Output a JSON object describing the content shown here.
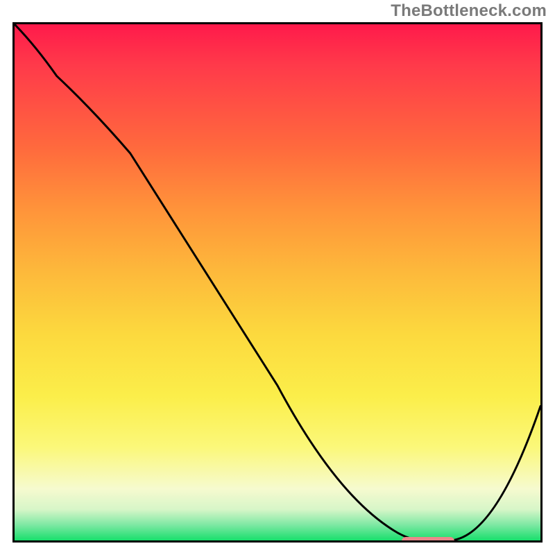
{
  "watermark": "TheBottleneck.com",
  "colors": {
    "border": "#000000",
    "curve": "#000000",
    "marker": "#e9878a",
    "gradient_stops": [
      "#ff1a4b",
      "#ff3a4a",
      "#ff6a3d",
      "#ff943a",
      "#fdb93b",
      "#fcd93e",
      "#fbee4a",
      "#fbf87a",
      "#f6facf",
      "#d7f6c8",
      "#7de8a3",
      "#18df6c"
    ]
  },
  "chart_data": {
    "type": "line",
    "title": "",
    "xlabel": "",
    "ylabel": "",
    "xlim": [
      0,
      100
    ],
    "ylim": [
      0,
      100
    ],
    "grid": false,
    "legend": false,
    "series": [
      {
        "name": "bottleneck-curve",
        "x": [
          0,
          8,
          22,
          50,
          72,
          78,
          83,
          100
        ],
        "values": [
          100,
          90,
          75,
          30,
          2,
          0,
          0,
          26
        ]
      }
    ],
    "marker": {
      "name": "optimal-range",
      "x_start": 73,
      "x_end": 83,
      "y": 0.7
    },
    "notes": "y is relative height 0-100 from bottom; curve starts top-left, kinks near x≈22, descends to a flat minimum around x≈74-83, then rises to ~26 at right edge."
  }
}
